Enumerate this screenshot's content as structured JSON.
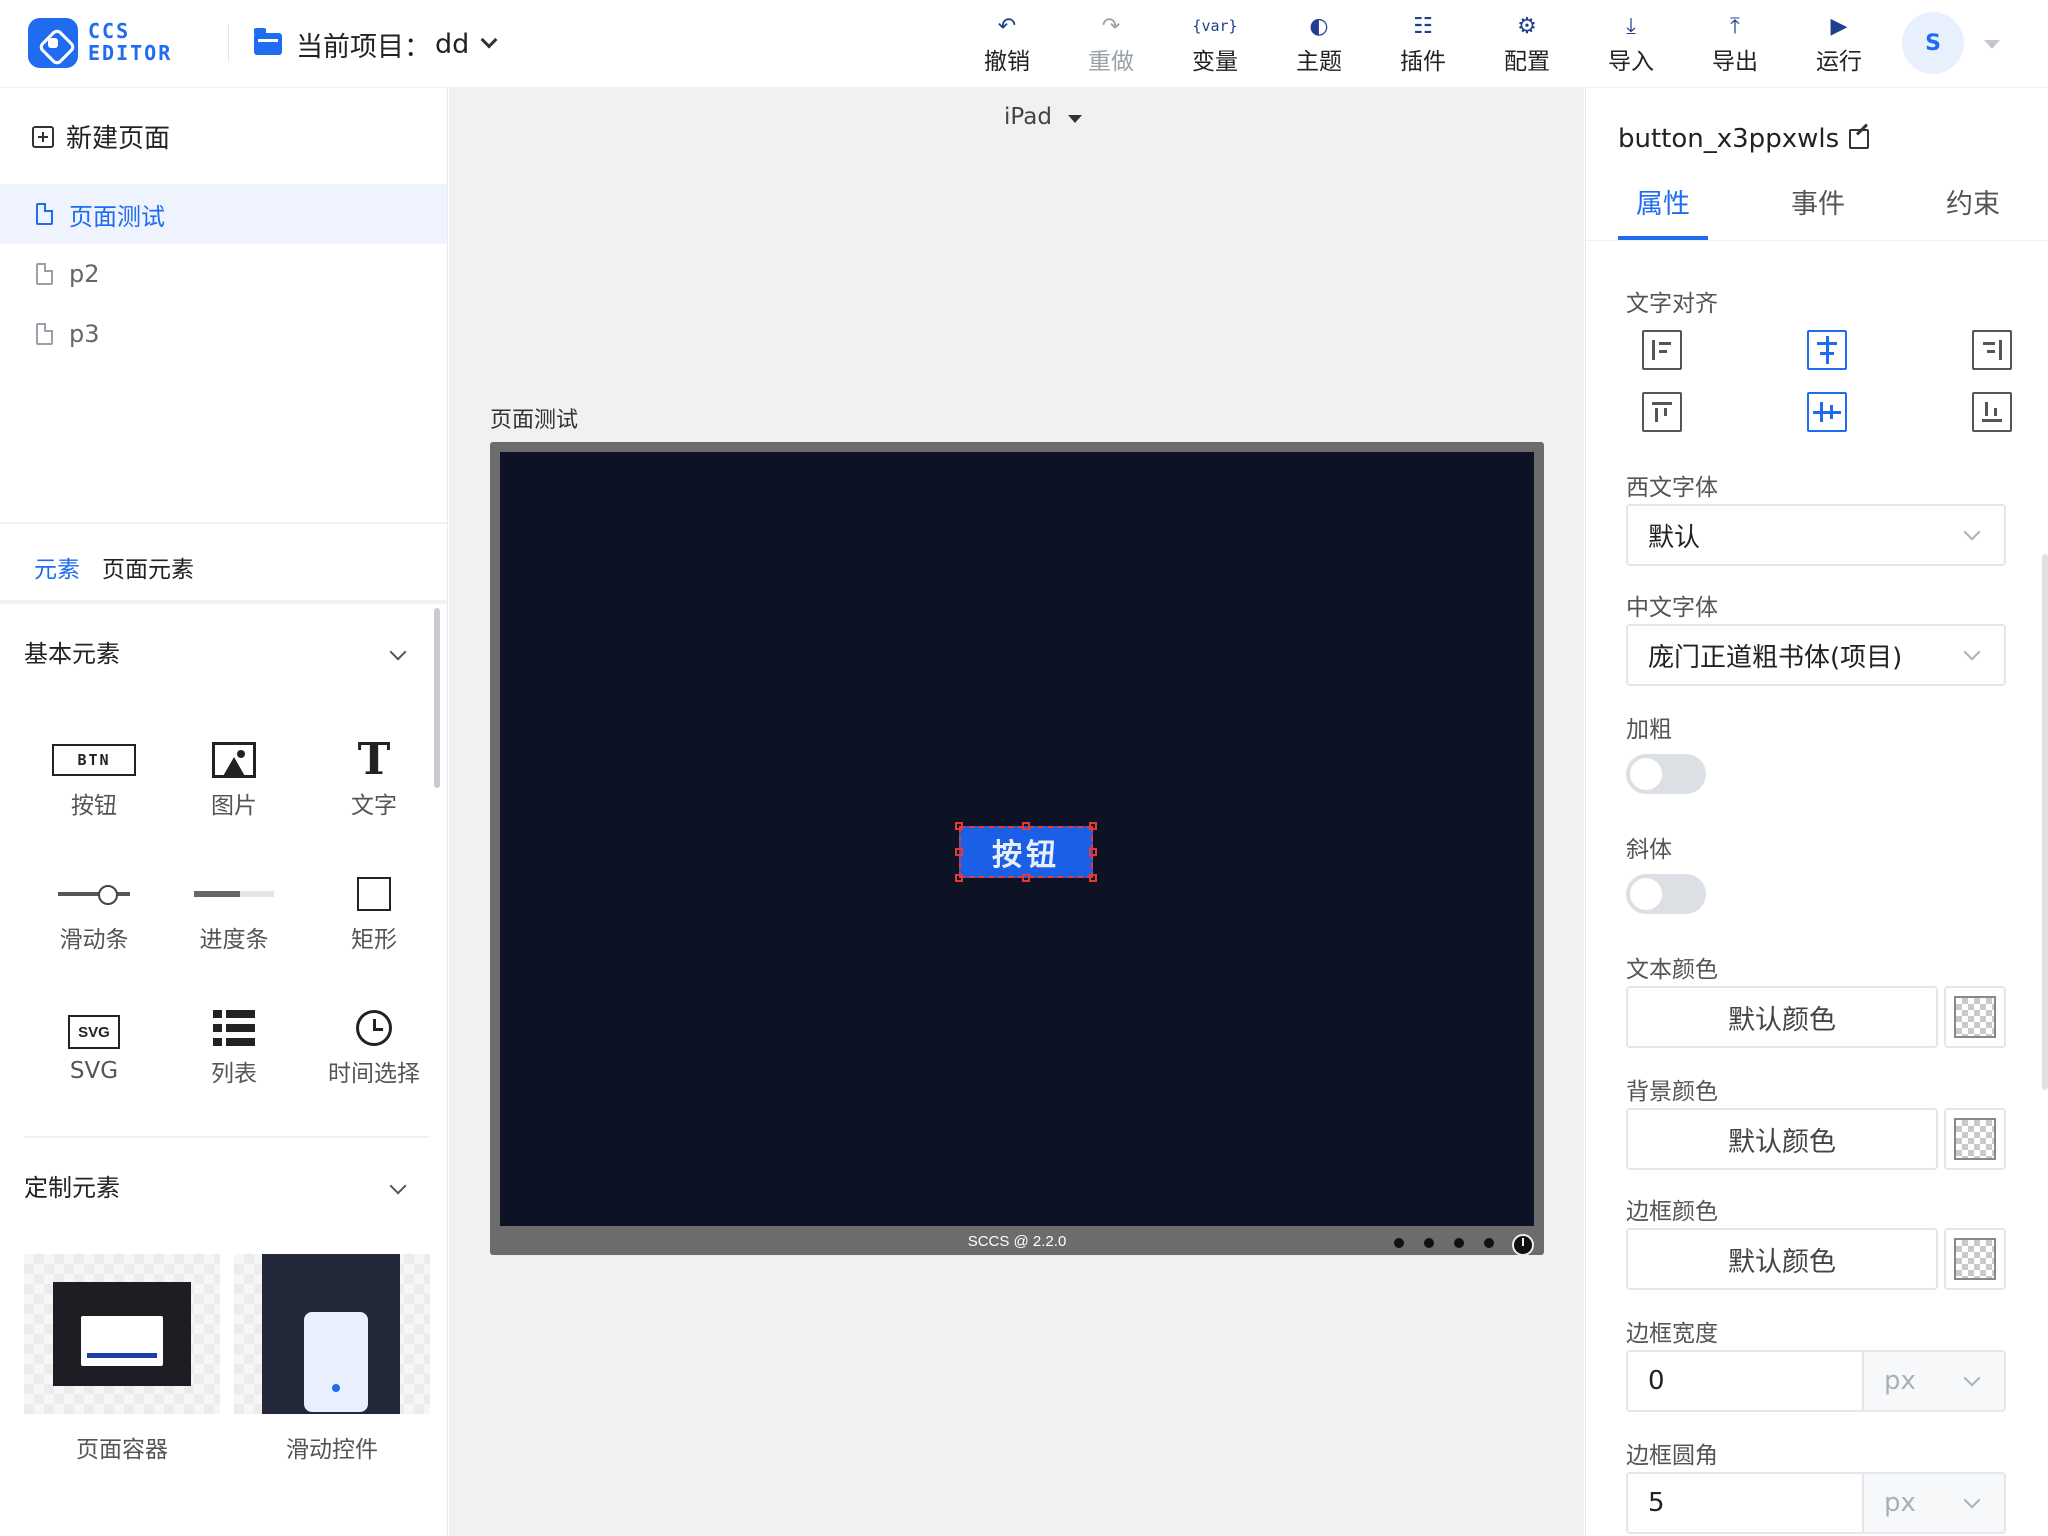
{
  "app": {
    "logo_line1": "CCS",
    "logo_line2": "EDITOR",
    "project_label": "当前项目：",
    "project_name": "dd"
  },
  "toolbar": {
    "undo": "撤销",
    "redo": "重做",
    "variables": "变量",
    "variables_icon_text": "{var}",
    "theme": "主题",
    "plugins": "插件",
    "config": "配置",
    "import": "导入",
    "export": "导出",
    "run": "运行"
  },
  "user": {
    "avatar_letter": "S"
  },
  "left": {
    "new_page": "新建页面",
    "pages": [
      {
        "label": "页面测试",
        "active": true
      },
      {
        "label": "p2",
        "active": false
      },
      {
        "label": "p3",
        "active": false
      }
    ],
    "tabs": [
      {
        "label": "元素",
        "active": true
      },
      {
        "label": "页面元素",
        "active": false
      }
    ],
    "basic_section": "基本元素",
    "basic_items": [
      {
        "label": "按钮",
        "icon": "button-icon",
        "icon_text": "BTN"
      },
      {
        "label": "图片",
        "icon": "image-icon"
      },
      {
        "label": "文字",
        "icon": "text-icon",
        "icon_text": "T"
      },
      {
        "label": "滑动条",
        "icon": "slider-icon"
      },
      {
        "label": "进度条",
        "icon": "progress-icon"
      },
      {
        "label": "矩形",
        "icon": "rectangle-icon"
      },
      {
        "label": "SVG",
        "icon": "svg-icon",
        "icon_text": "SVG"
      },
      {
        "label": "列表",
        "icon": "list-icon"
      },
      {
        "label": "时间选择",
        "icon": "clock-icon"
      }
    ],
    "custom_section": "定制元素",
    "custom_items": [
      {
        "label": "页面容器"
      },
      {
        "label": "滑动控件"
      }
    ]
  },
  "canvas": {
    "device": "iPad",
    "page_title": "页面测试",
    "footer": "SCCS @ 2.2.0",
    "button_text": "按钮",
    "screen_color": "#0e1225",
    "button_color": "#1b5fe6"
  },
  "props": {
    "component_name": "button_x3ppxwls",
    "tabs": [
      {
        "label": "属性",
        "active": true
      },
      {
        "label": "事件",
        "active": false
      },
      {
        "label": "约束",
        "active": false
      }
    ],
    "text_align_label": "文字对齐",
    "western_font_label": "西文字体",
    "western_font_value": "默认",
    "chinese_font_label": "中文字体",
    "chinese_font_value": "庞门正道粗书体(项目)",
    "bold_label": "加粗",
    "bold_value": false,
    "italic_label": "斜体",
    "italic_value": false,
    "text_color_label": "文本颜色",
    "text_color_value": "默认颜色",
    "bg_color_label": "背景颜色",
    "bg_color_value": "默认颜色",
    "border_color_label": "边框颜色",
    "border_color_value": "默认颜色",
    "border_width_label": "边框宽度",
    "border_width_value": "0",
    "border_width_unit": "px",
    "border_radius_label": "边框圆角",
    "border_radius_value": "5",
    "border_radius_unit": "px"
  },
  "colors": {
    "accent": "#1f6cf0"
  }
}
